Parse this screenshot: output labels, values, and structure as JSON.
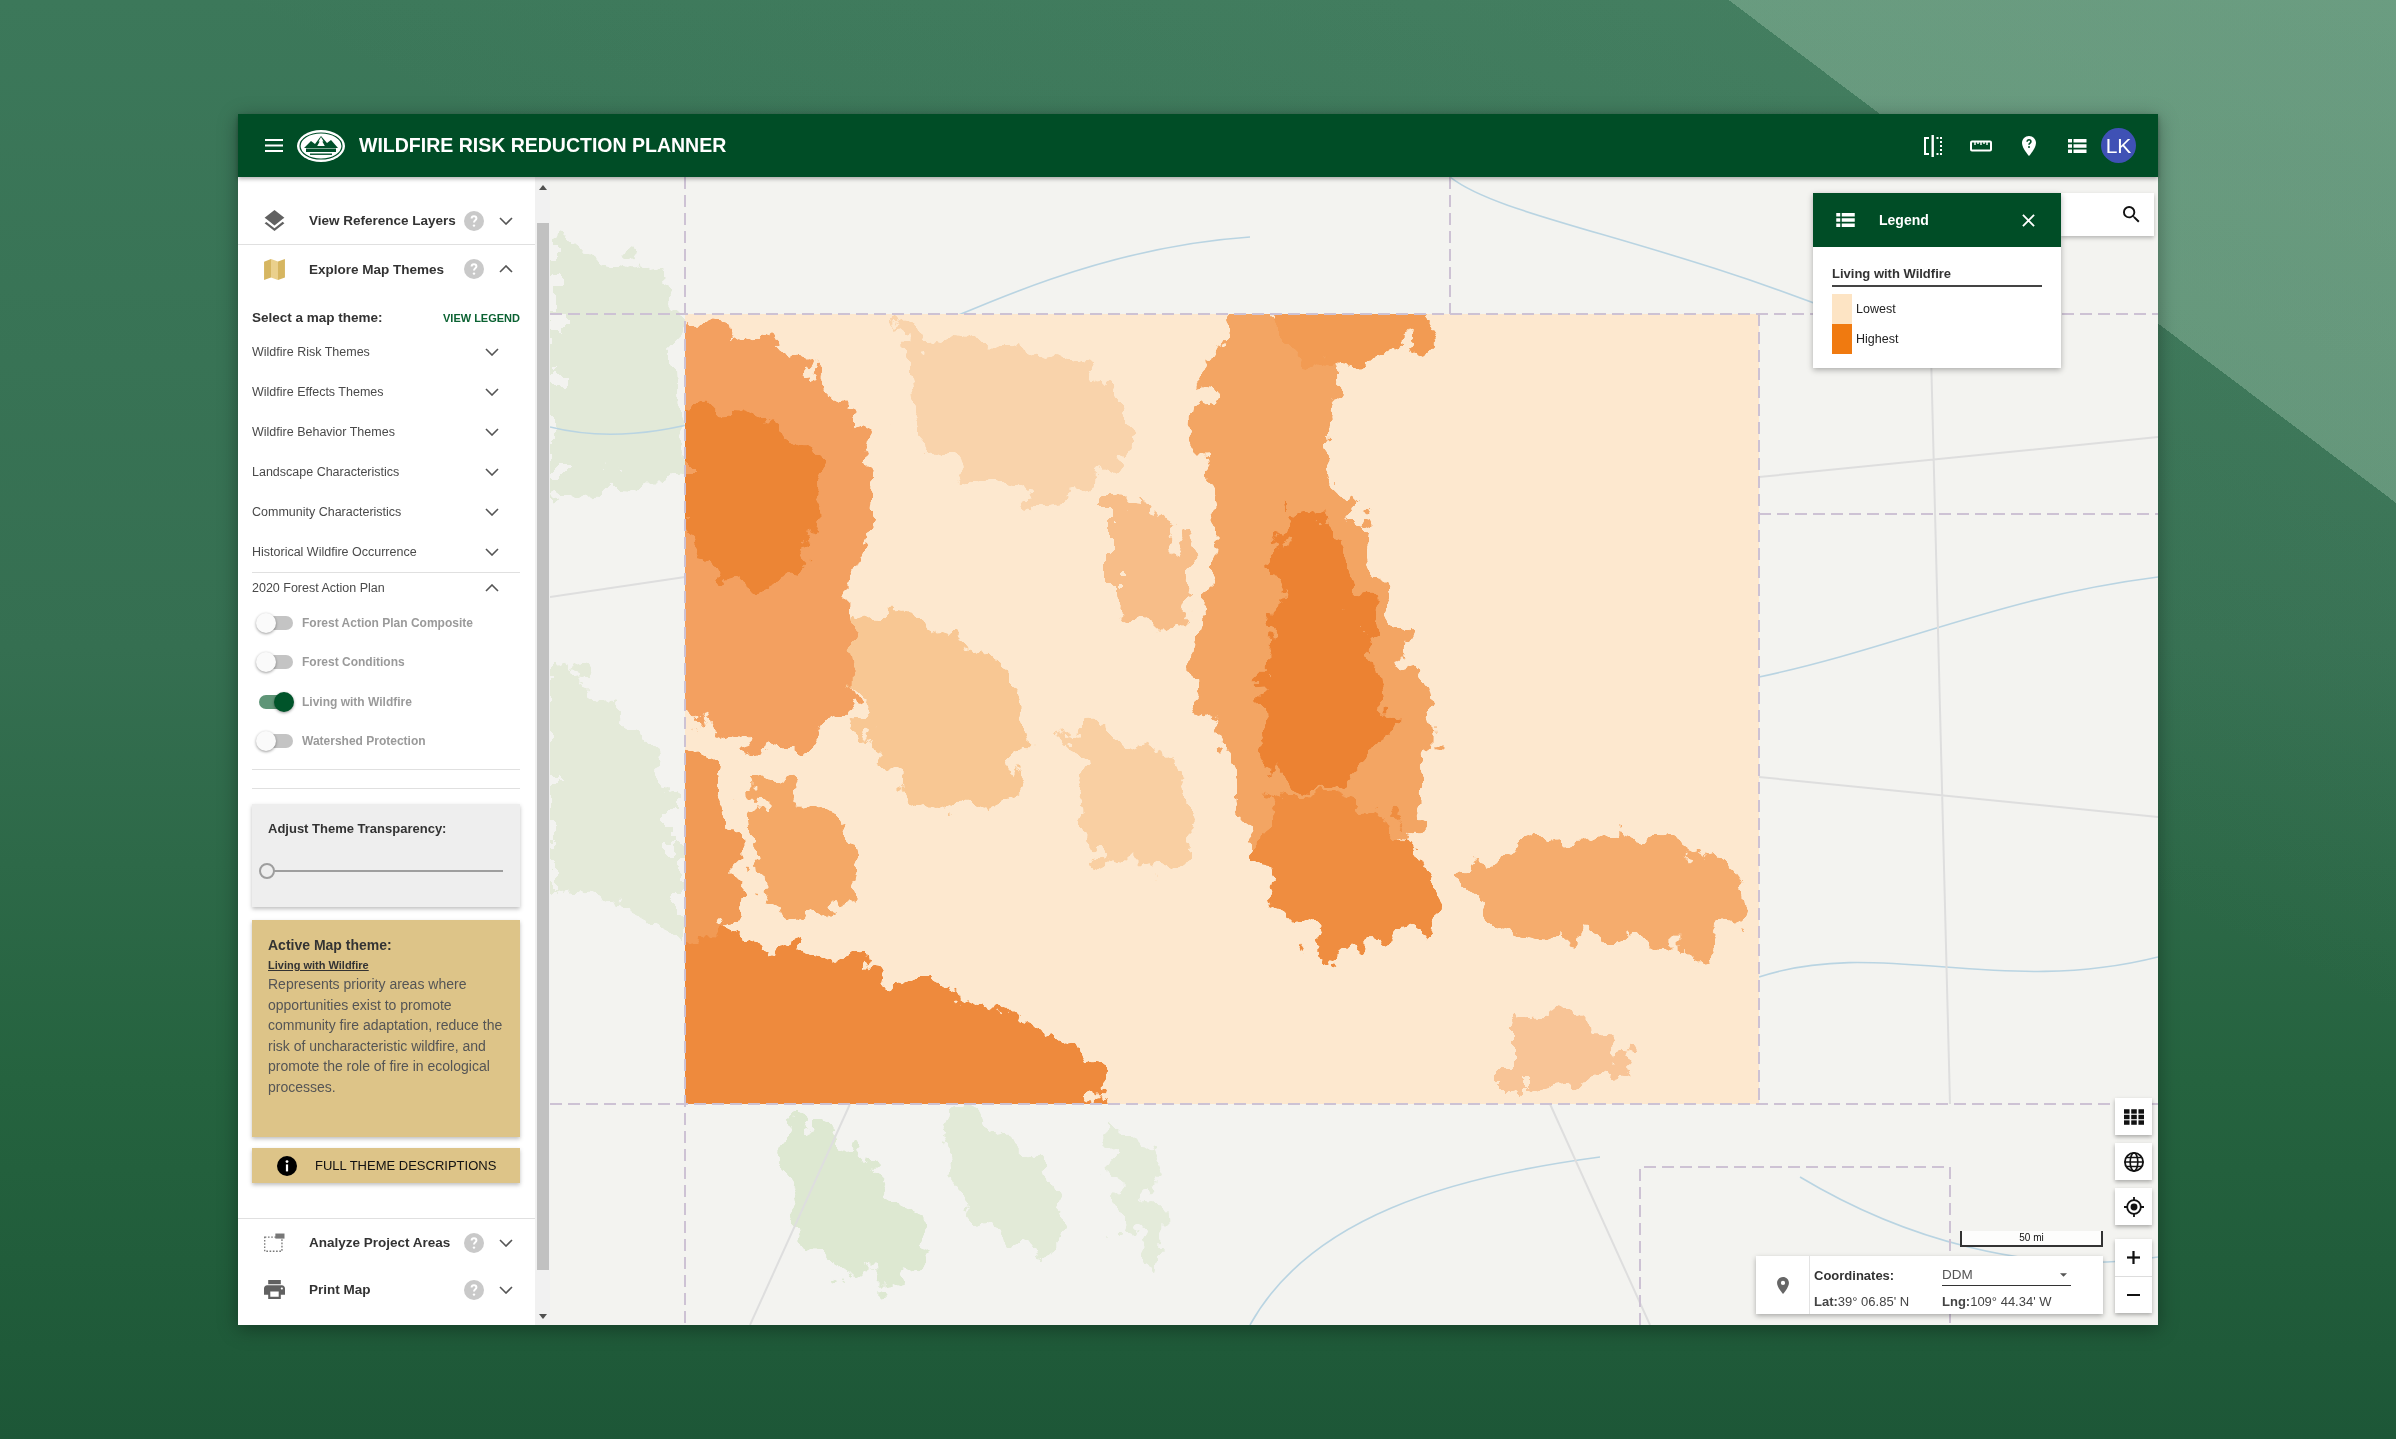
{
  "header": {
    "title": "WILDFIRE RISK REDUCTION PLANNER",
    "avatar": "LK"
  },
  "sidebar": {
    "sections": [
      {
        "kind": "layers",
        "label": "View Reference Layers",
        "expanded": false
      },
      {
        "kind": "themes",
        "label": "Explore Map Themes",
        "expanded": true,
        "panel": {
          "prompt": "Select a map theme:",
          "legend_link": "VIEW LEGEND",
          "groups": [
            {
              "label": "Wildfire Risk Themes",
              "expanded": false
            },
            {
              "label": "Wildfire Effects Themes",
              "expanded": false
            },
            {
              "label": "Wildfire Behavior Themes",
              "expanded": false
            },
            {
              "label": "Landscape Characteristics",
              "expanded": false
            },
            {
              "label": "Community Characteristics",
              "expanded": false
            },
            {
              "label": "Historical Wildfire Occurrence",
              "expanded": false
            },
            {
              "label": "2020 Forest Action Plan",
              "expanded": true,
              "children": [
                {
                  "label": "Forest Action Plan Composite",
                  "on": false
                },
                {
                  "label": "Forest Conditions",
                  "on": false
                },
                {
                  "label": "Living with Wildfire",
                  "on": true
                },
                {
                  "label": "Watershed Protection",
                  "on": false
                }
              ]
            }
          ],
          "transparency": {
            "title": "Adjust Theme Transparency:",
            "level": 0
          },
          "active_theme": {
            "heading": "Active Map theme:",
            "name": "Living with Wildfire",
            "description": "Represents priority areas where opportunities exist to promote community fire adaptation, reduce the risk of uncharacteristic wildfire, and promote the role of fire in ecological processes."
          },
          "button": "FULL THEME DESCRIPTIONS"
        }
      },
      {
        "kind": "analyze",
        "label": "Analyze Project Areas",
        "expanded": false
      },
      {
        "kind": "print",
        "label": "Print Map",
        "expanded": false
      }
    ]
  },
  "map": {
    "legend": {
      "title": "Legend",
      "layer": "Living with Wildfire",
      "items": [
        {
          "label": "Lowest",
          "color": "#fde4c4"
        },
        {
          "label": "Highest",
          "color": "#f07a10"
        }
      ]
    },
    "scale": "50 mi",
    "coordinates": {
      "label": "Coordinates:",
      "format": "DDM",
      "latitude": "**Lat:**39° 06.85' N",
      "longitude": "**Lng:**109° 44.34' W"
    }
  }
}
